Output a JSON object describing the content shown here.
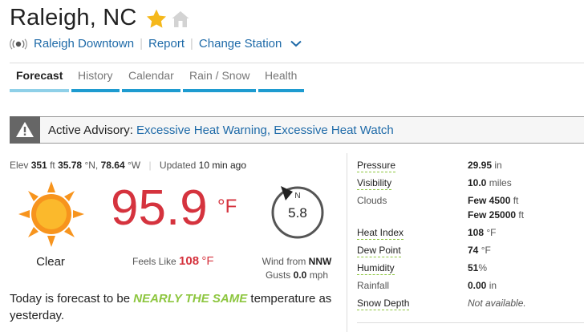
{
  "header": {
    "city": "Raleigh, NC",
    "station": "Raleigh Downtown",
    "report": "Report",
    "change_station": "Change Station"
  },
  "tabs": [
    {
      "label": "Forecast",
      "active": true
    },
    {
      "label": "History"
    },
    {
      "label": "Calendar"
    },
    {
      "label": "Rain / Snow"
    },
    {
      "label": "Health"
    }
  ],
  "advisory": {
    "label": "Active Advisory:",
    "items": "Excessive Heat Warning, Excessive Heat Watch"
  },
  "meta": {
    "elev_label": "Elev",
    "elev": "351",
    "elev_unit": "ft",
    "lat": "35.78",
    "lat_unit": "°N,",
    "lon": "78.64",
    "lon_unit": "°W",
    "updated_label": "Updated",
    "updated": "10 min ago"
  },
  "current": {
    "condition": "Clear",
    "temp": "95.9",
    "temp_unit": "°F",
    "feels_label": "Feels Like",
    "feels": "108",
    "feels_unit": "°F",
    "wind_dir_letter": "N",
    "wind_speed": "5.8",
    "wind_from_label": "Wind from",
    "wind_from": "NNW",
    "gusts_label": "Gusts",
    "gusts": "0.0",
    "gusts_unit": "mph"
  },
  "today": {
    "prefix": "Today is forecast to be",
    "highlight": "NEARLY THE SAME",
    "suffix": "temperature as yesterday."
  },
  "stats": {
    "pressure": {
      "label": "Pressure",
      "value": "29.95",
      "unit": "in"
    },
    "visibility": {
      "label": "Visibility",
      "value": "10.0",
      "unit": "miles"
    },
    "clouds": {
      "label": "Clouds",
      "value1": "Few 4500",
      "unit1": "ft",
      "value2": "Few 25000",
      "unit2": "ft"
    },
    "heat_index": {
      "label": "Heat Index",
      "value": "108",
      "unit": "°F"
    },
    "dew_point": {
      "label": "Dew Point",
      "value": "74",
      "unit": "°F"
    },
    "humidity": {
      "label": "Humidity",
      "value": "51",
      "unit": "%"
    },
    "rainfall": {
      "label": "Rainfall",
      "value": "0.00",
      "unit": "in"
    },
    "snow_depth": {
      "label": "Snow Depth",
      "value": "Not available."
    }
  },
  "icons": {
    "star": "star-icon",
    "home": "home-icon",
    "broadcast": "broadcast-icon",
    "chevron": "chevron-down-icon",
    "warning": "warning-icon",
    "sun": "sun-icon",
    "wind": "wind-compass-icon"
  },
  "colors": {
    "link": "#1e6aa8",
    "temp": "#d5333e",
    "star": "#f5b81b",
    "tab_underline": "#1e9bd0",
    "tab_underline_active": "#8fd0e8",
    "highlight": "#8dc63f"
  }
}
